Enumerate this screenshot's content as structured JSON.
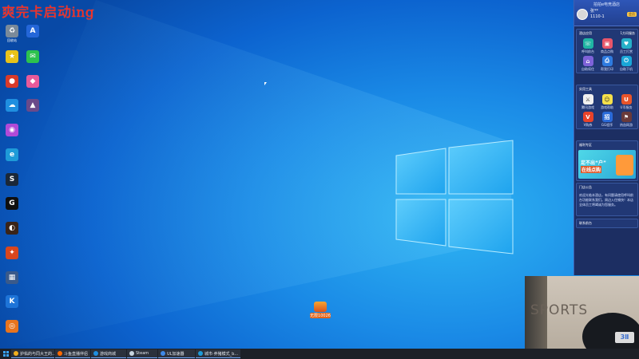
{
  "overlay": {
    "title": "爽完卡启动ing"
  },
  "desktop": {
    "icons": [
      {
        "name": "recycle-bin-icon",
        "label": "回收站",
        "color": "#7a8a9a",
        "glyph": "♻"
      },
      {
        "name": "app-blue-icon",
        "label": "",
        "color": "#2466d8",
        "glyph": "A"
      },
      {
        "name": "app-yellow-icon",
        "label": "",
        "color": "#e8c21a",
        "glyph": "★"
      },
      {
        "name": "wechat-icon",
        "label": "",
        "color": "#2dc24e",
        "glyph": "✉"
      },
      {
        "name": "app-red-icon",
        "label": "",
        "color": "#d83a2a",
        "glyph": "●"
      },
      {
        "name": "app-pink-icon",
        "label": "",
        "color": "#e85a9a",
        "glyph": "◆"
      },
      {
        "name": "cloud-drive-icon",
        "label": "",
        "color": "#1f8fe0",
        "glyph": "☁"
      },
      {
        "name": "game-avatar-icon",
        "label": "",
        "color": "#6a4a8a",
        "glyph": "▲"
      },
      {
        "name": "app-colorful-icon",
        "label": "",
        "color": "#b04ad8",
        "glyph": "◉"
      },
      {
        "name": "edge-browser-icon",
        "label": "",
        "color": "#1e9bd8",
        "glyph": "e"
      },
      {
        "name": "steam-icon",
        "label": "",
        "color": "#1b2838",
        "glyph": "S"
      },
      {
        "name": "game-g-icon",
        "label": "",
        "color": "#0f0f0f",
        "glyph": "G"
      },
      {
        "name": "game-dark-icon",
        "label": "",
        "color": "#3a2418",
        "glyph": "◐"
      },
      {
        "name": "game-fire-icon",
        "label": "",
        "color": "#d8461e",
        "glyph": "✦"
      },
      {
        "name": "app-grid-icon",
        "label": "",
        "color": "#3a5a8a",
        "glyph": "▦"
      },
      {
        "name": "app-k-icon",
        "label": "",
        "color": "#1e74d8",
        "glyph": "K"
      },
      {
        "name": "app-orange-icon",
        "label": "",
        "color": "#e8741e",
        "glyph": "◎"
      }
    ],
    "center_icon": {
      "label": "无限10026"
    }
  },
  "side_panel": {
    "head_title": "拍拍e电竞酒店",
    "user": {
      "name": "张**",
      "id": "1110-1",
      "vip": "会员"
    },
    "sections": [
      {
        "title": "酒店应用",
        "extra": "1方问服务",
        "items": [
          {
            "name": "app-phone",
            "label": "呼叫前台",
            "color": "#1fb5a3",
            "glyph": "☏"
          },
          {
            "name": "app-shop",
            "label": "商品点购",
            "color": "#e8566a",
            "glyph": "▣"
          },
          {
            "name": "app-staff",
            "label": "员工打赏",
            "color": "#26b0c8",
            "glyph": "♥"
          },
          {
            "name": "app-checkin",
            "label": "自助续住",
            "color": "#7e62d8",
            "glyph": "⌂"
          },
          {
            "name": "app-invoice",
            "label": "帮我打印",
            "color": "#2e7be0",
            "glyph": "⎙"
          },
          {
            "name": "app-phone-charge",
            "label": "自助下机",
            "color": "#19a6d8",
            "glyph": "⏻"
          }
        ]
      },
      {
        "title": "实用工具",
        "extra": "",
        "items": [
          {
            "name": "tool-game1",
            "label": "腾讯游戏",
            "color": "#f0f0f0",
            "glyph": "⚔"
          },
          {
            "name": "tool-game2",
            "label": "游戏帮助",
            "color": "#f5e04a",
            "glyph": "☺"
          },
          {
            "name": "tool-u",
            "label": "U币服务",
            "color": "#e8542a",
            "glyph": "U"
          },
          {
            "name": "tool-v",
            "label": "V购券",
            "color": "#e8422a",
            "glyph": "V"
          },
          {
            "name": "tool-zhao",
            "label": "GG程序",
            "color": "#2a6ad8",
            "glyph": "招"
          },
          {
            "name": "tool-game3",
            "label": "热血网游",
            "color": "#6a3a3a",
            "glyph": "⚑"
          }
        ]
      }
    ],
    "promo": {
      "title": "福利专区",
      "line1": "足不出“户”",
      "line2": "在线点购"
    },
    "notice": {
      "title": "门店公告",
      "text": "欢迎光临本酒店，有问题请使用呼叫前台功能联系我们。周边入住愉快！本店全体员工将竭诚为您服务。"
    },
    "contact": {
      "title": "联系前台"
    }
  },
  "webcam": {
    "sign_text": "SPORTS",
    "logo_text": "3Ⅱ"
  },
  "taskbar": {
    "items": [
      {
        "name": "taskbar-chrome-1",
        "label": "护佑的与同大王的...",
        "color": "#f2b01e"
      },
      {
        "name": "taskbar-douyu",
        "label": "斗鱼直播伴侣",
        "color": "#ff6a00"
      },
      {
        "name": "taskbar-cloud",
        "label": "游戏商城",
        "color": "#1f8fe0"
      },
      {
        "name": "taskbar-steam",
        "label": "Steam",
        "color": "#c7d5e0"
      },
      {
        "name": "taskbar-ul",
        "label": "UL加速器",
        "color": "#3e89e8"
      },
      {
        "name": "taskbar-edge",
        "label": "城市·养猪模式_b...",
        "color": "#1e9bd8"
      }
    ]
  }
}
